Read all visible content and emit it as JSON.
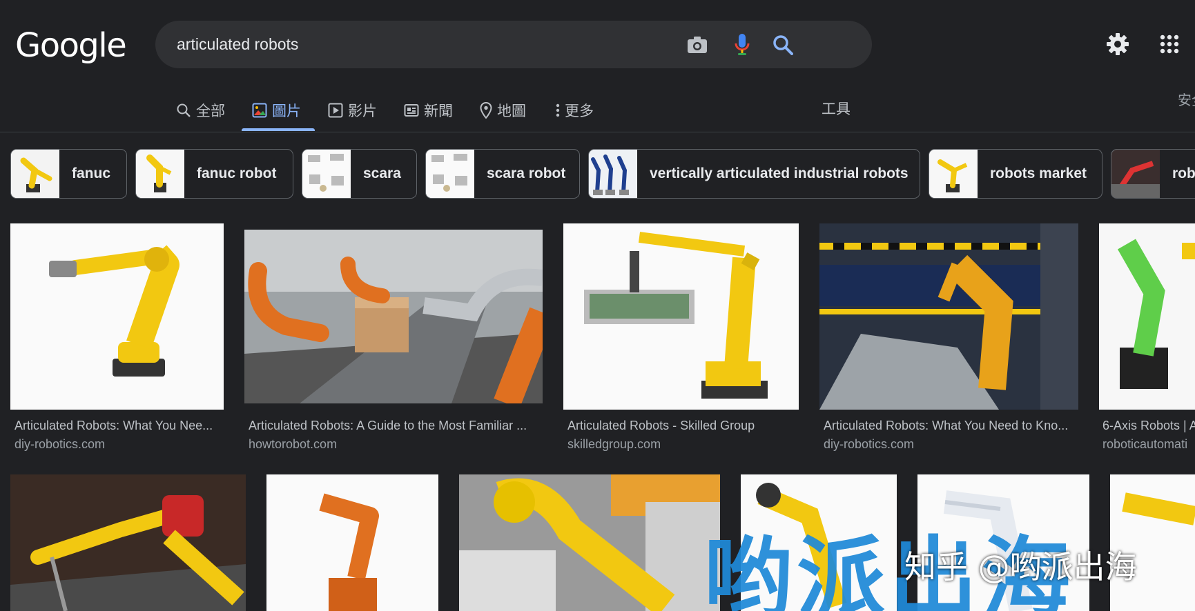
{
  "header": {
    "logo": "Google",
    "query": "articulated robots"
  },
  "tabs": [
    {
      "label": "全部",
      "icon": "search-icon"
    },
    {
      "label": "圖片",
      "icon": "image-icon",
      "active": true
    },
    {
      "label": "影片",
      "icon": "play-icon"
    },
    {
      "label": "新聞",
      "icon": "news-icon"
    },
    {
      "label": "地圖",
      "icon": "map-pin-icon"
    },
    {
      "label": "更多",
      "icon": "more-dots-icon"
    }
  ],
  "tools_label": "工具",
  "safe_search_label": "安全",
  "chips": [
    {
      "label": "fanuc"
    },
    {
      "label": "fanuc robot"
    },
    {
      "label": "scara"
    },
    {
      "label": "scara robot"
    },
    {
      "label": "vertically articulated industrial robots"
    },
    {
      "label": "robots market"
    },
    {
      "label": "rob"
    }
  ],
  "results_row1": [
    {
      "title": "Articulated Robots: What You Nee...",
      "site": "diy-robotics.com"
    },
    {
      "title": "Articulated Robots: A Guide to the Most Familiar ...",
      "site": "howtorobot.com"
    },
    {
      "title": "Articulated Robots - Skilled Group",
      "site": "skilledgroup.com"
    },
    {
      "title": "Articulated Robots: What You Need to Kno...",
      "site": "diy-robotics.com"
    },
    {
      "title": "6-Axis Robots | A",
      "site": "roboticautomati"
    }
  ],
  "watermark": {
    "big": "哟派出海",
    "small": "知乎 @哟派出海"
  },
  "colors": {
    "background": "#202124",
    "accent": "#8ab4f8",
    "search_box": "#303134",
    "robot_yellow": "#f2c811",
    "robot_orange": "#e07020",
    "robot_green": "#5fce4a",
    "watermark_blue": "#1f8ad8"
  }
}
